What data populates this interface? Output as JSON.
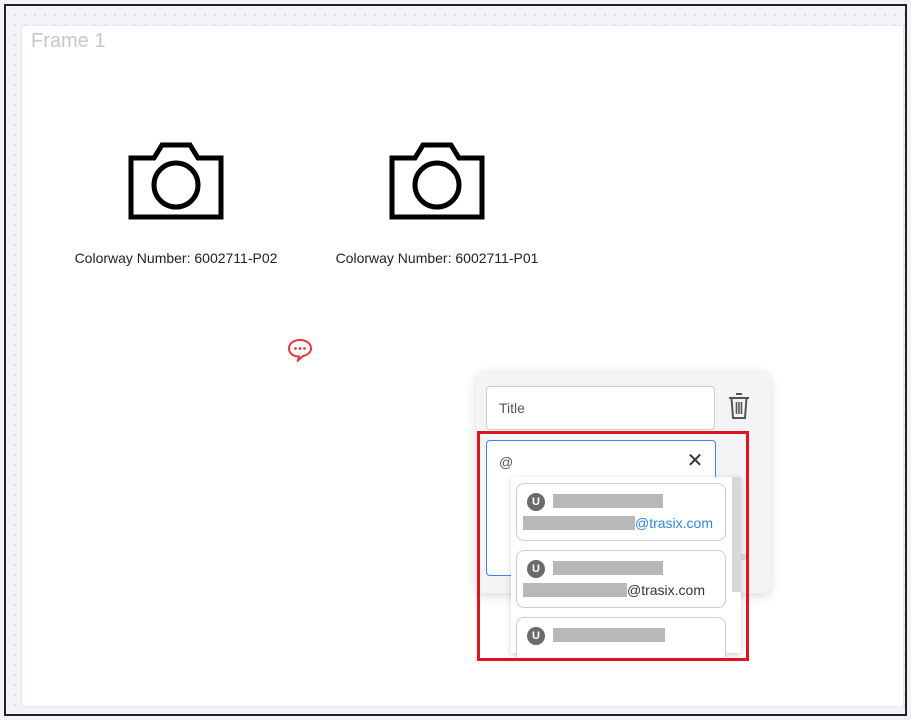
{
  "frame": {
    "title": "Frame 1"
  },
  "colorways": [
    {
      "label": "Colorway Number: 6002711-P02",
      "icon": "camera-icon"
    },
    {
      "label": "Colorway Number: 6002711-P01",
      "icon": "camera-icon"
    }
  ],
  "comment": {
    "title_placeholder": "Title",
    "mention_value": "@",
    "clear_symbol": "✕"
  },
  "suggestions": [
    {
      "avatar": "U",
      "domain": "@trasix.com",
      "domain_color": "#2f86d8"
    },
    {
      "avatar": "U",
      "domain": "@trasix.com",
      "domain_color": "#333333"
    },
    {
      "avatar": "U",
      "domain": "",
      "domain_color": "#333333"
    }
  ],
  "colors": {
    "highlight": "#e0141c",
    "comment_pin": "#e23b3b",
    "focus": "#3b82f6"
  }
}
